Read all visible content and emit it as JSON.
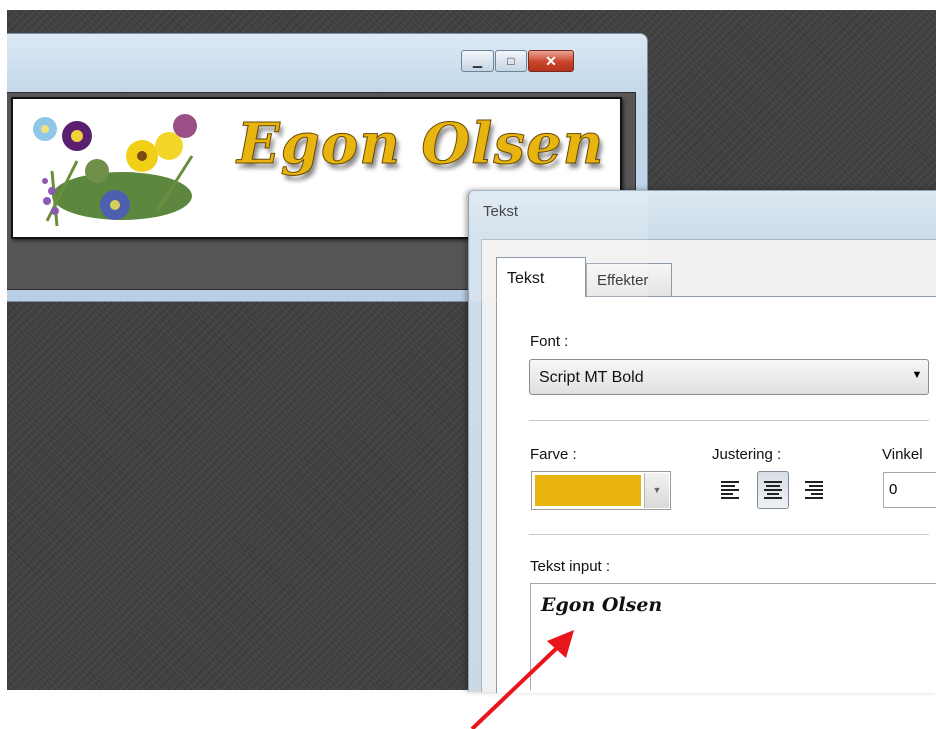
{
  "background_window": {
    "controls": {
      "minimize": "▭",
      "maximize": "▢",
      "close": "✕"
    },
    "banner": {
      "text": "Egon Olsen",
      "text_color": "#e9b40e"
    }
  },
  "dialog": {
    "title": "Tekst",
    "tabs": [
      {
        "label": "Tekst",
        "active": true
      },
      {
        "label": "Effekter",
        "active": false
      }
    ],
    "font": {
      "label": "Font :",
      "value": "Script MT Bold"
    },
    "color": {
      "label": "Farve :",
      "value": "#e9b40e"
    },
    "alignment": {
      "label": "Justering :",
      "options": [
        "left",
        "center",
        "right"
      ],
      "selected": "center"
    },
    "angle": {
      "label": "Vinkel",
      "value": "0"
    },
    "text_input": {
      "label": "Tekst input :",
      "value": "Egon Olsen"
    }
  },
  "annotation": {
    "arrow_color": "#e8151b"
  }
}
